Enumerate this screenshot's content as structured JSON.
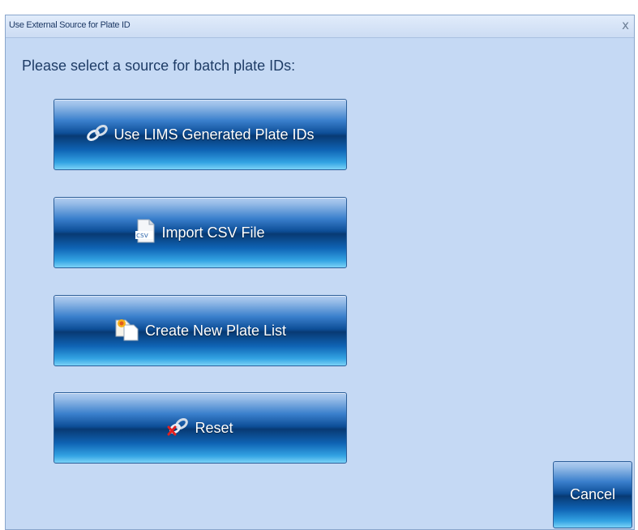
{
  "window": {
    "title": "Use External Source for Plate ID",
    "close_glyph": "x"
  },
  "prompt": "Please select a source for batch plate IDs:",
  "buttons": {
    "lims": {
      "label": "Use LIMS Generated Plate IDs",
      "icon": "chain-link-icon"
    },
    "csv": {
      "label": "Import CSV File",
      "icon": "csv-file-icon",
      "icon_text": "csv"
    },
    "create": {
      "label": "Create New Plate List",
      "icon": "new-document-icon"
    },
    "reset": {
      "label": "Reset",
      "icon": "broken-link-icon"
    }
  },
  "cancel_label": "Cancel",
  "colors": {
    "dialog_background": "#c5d9f4",
    "button_dark": "#0d4e97",
    "button_light": "#7ad2f7",
    "text": "#1e3c66"
  }
}
